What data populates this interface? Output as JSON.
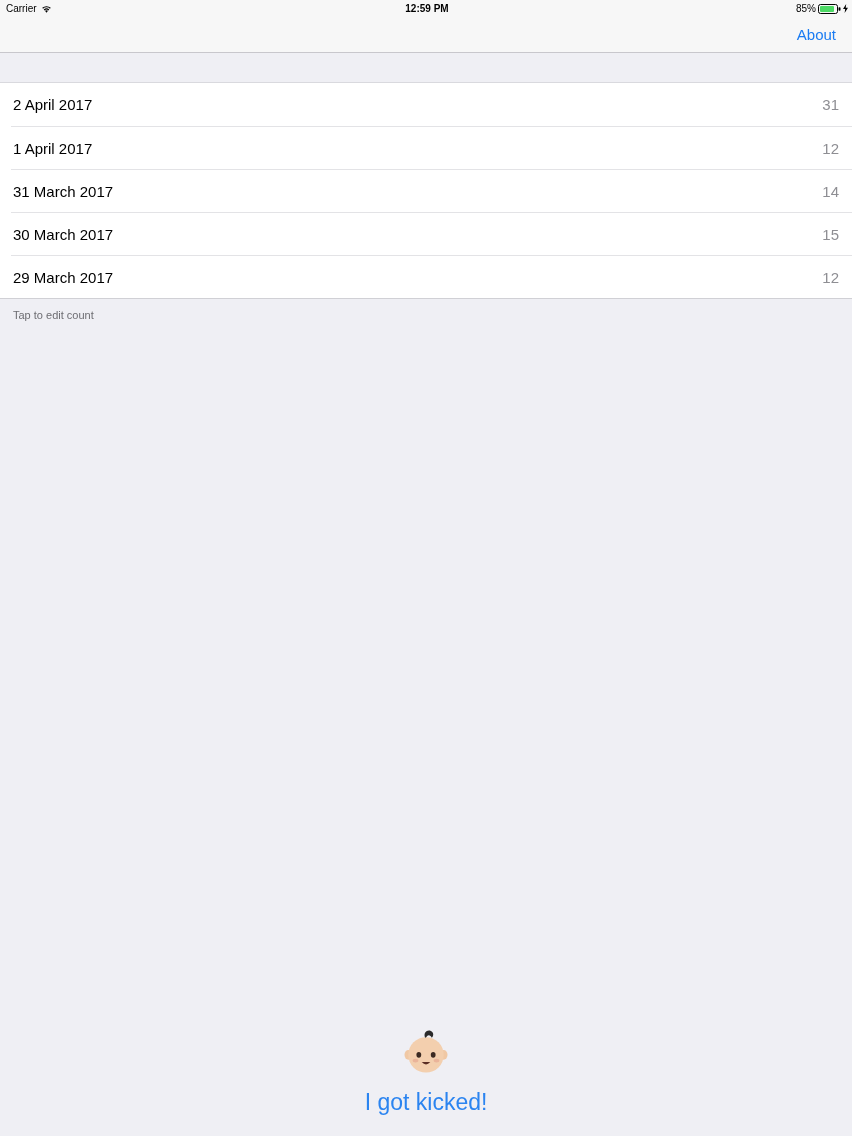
{
  "status_bar": {
    "carrier": "Carrier",
    "time": "12:59 PM",
    "battery": "85%"
  },
  "nav_bar": {
    "right_button": "About"
  },
  "list": {
    "rows": [
      {
        "date": "2 April 2017",
        "count": "31"
      },
      {
        "date": "1 April 2017",
        "count": "12"
      },
      {
        "date": "31 March 2017",
        "count": "14"
      },
      {
        "date": "30 March 2017",
        "count": "15"
      },
      {
        "date": "29 March 2017",
        "count": "12"
      }
    ],
    "footer": "Tap to edit count"
  },
  "kick_button": {
    "label": "I got kicked!"
  }
}
